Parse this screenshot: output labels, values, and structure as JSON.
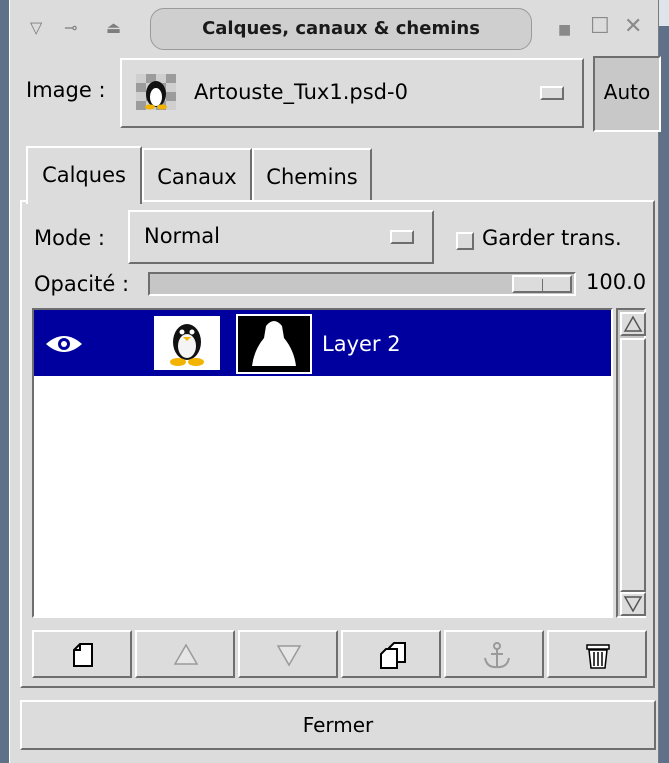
{
  "window": {
    "title": "Calques, canaux & chemins"
  },
  "image_row": {
    "label": "Image :",
    "selected_image": "Artouste_Tux1.psd-0",
    "auto_label": "Auto"
  },
  "tabs": [
    {
      "label": "Calques",
      "active": true
    },
    {
      "label": "Canaux",
      "active": false
    },
    {
      "label": "Chemins",
      "active": false
    }
  ],
  "mode": {
    "label": "Mode :",
    "value": "Normal"
  },
  "keep_trans": {
    "label": "Garder trans.",
    "checked": false
  },
  "opacity": {
    "label": "Opacité :",
    "value": "100.0",
    "fraction": 1.0
  },
  "layers": [
    {
      "name": "Layer 2",
      "visible": true,
      "selected": true
    }
  ],
  "toolbar_icons": [
    "new-layer-icon",
    "raise-layer-icon",
    "lower-layer-icon",
    "duplicate-layer-icon",
    "anchor-layer-icon",
    "delete-layer-icon"
  ],
  "close_label": "Fermer",
  "colors": {
    "selection": "#00009e",
    "window_bg": "#dcdcdc"
  }
}
